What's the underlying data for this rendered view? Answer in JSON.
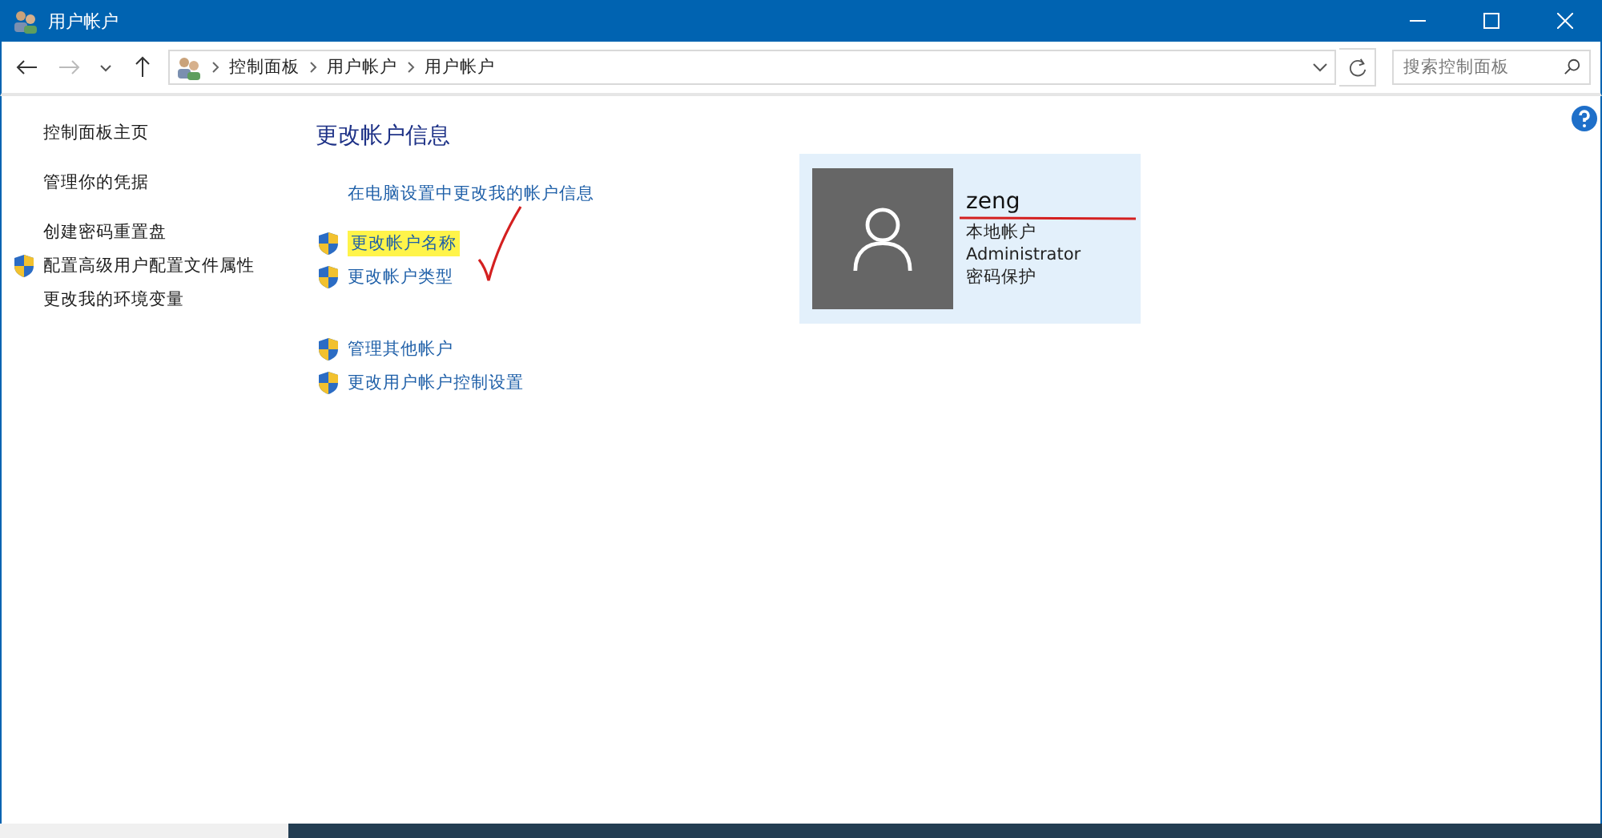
{
  "window": {
    "title": "用户帐户"
  },
  "breadcrumb": [
    "控制面板",
    "用户帐户",
    "用户帐户"
  ],
  "search": {
    "placeholder": "搜索控制面板"
  },
  "sidebar": {
    "items": [
      {
        "label": "控制面板主页",
        "shield": false
      },
      {
        "label": "管理你的凭据",
        "shield": false
      },
      {
        "label": "创建密码重置盘",
        "shield": false
      },
      {
        "label": "配置高级用户配置文件属性",
        "shield": true
      },
      {
        "label": "更改我的环境变量",
        "shield": false
      }
    ]
  },
  "main": {
    "heading": "更改帐户信息",
    "links": [
      {
        "label": "在电脑设置中更改我的帐户信息",
        "shield": false,
        "highlighted": false
      },
      {
        "label": "更改帐户名称",
        "shield": true,
        "highlighted": true
      },
      {
        "label": "更改帐户类型",
        "shield": true,
        "highlighted": false
      },
      {
        "label": "管理其他帐户",
        "shield": true,
        "highlighted": false
      },
      {
        "label": "更改用户帐户控制设置",
        "shield": true,
        "highlighted": false
      }
    ]
  },
  "account": {
    "name": "zeng",
    "details": [
      "本地帐户",
      "Administrator",
      "密码保护"
    ]
  }
}
